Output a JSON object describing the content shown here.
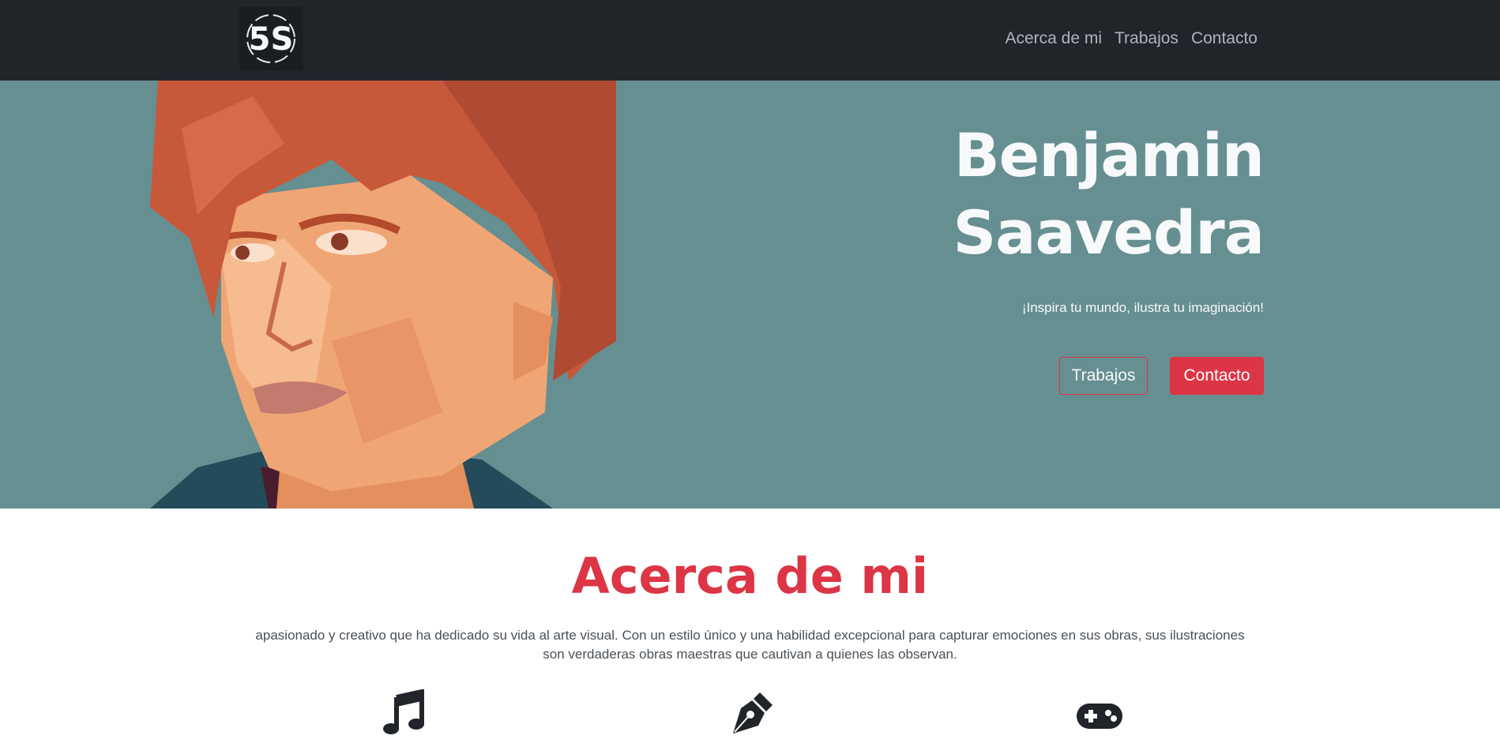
{
  "navbar": {
    "logo_text": "5S",
    "links": [
      "Acerca de mi",
      "Trabajos",
      "Contacto"
    ]
  },
  "hero": {
    "title_line1": "Benjamin",
    "title_line2": "Saavedra",
    "tagline": "¡Inspira tu mundo, ilustra tu imaginación!",
    "buttons": {
      "works": "Trabajos",
      "contact": "Contacto"
    }
  },
  "about": {
    "title": "Acerca de mi",
    "text": "apasionado y creativo que ha dedicado su vida al arte visual. Con un estilo único y una habilidad excepcional para capturar emociones en sus obras, sus ilustraciones son verdaderas obras maestras que cautivan a quienes las observan.",
    "icons": [
      "music-icon",
      "pen-nib-icon",
      "gamepad-icon"
    ]
  },
  "colors": {
    "navbar_bg": "#212529",
    "hero_bg": "#668f91",
    "accent": "#dc3545",
    "nav_text": "#adb5bd"
  }
}
